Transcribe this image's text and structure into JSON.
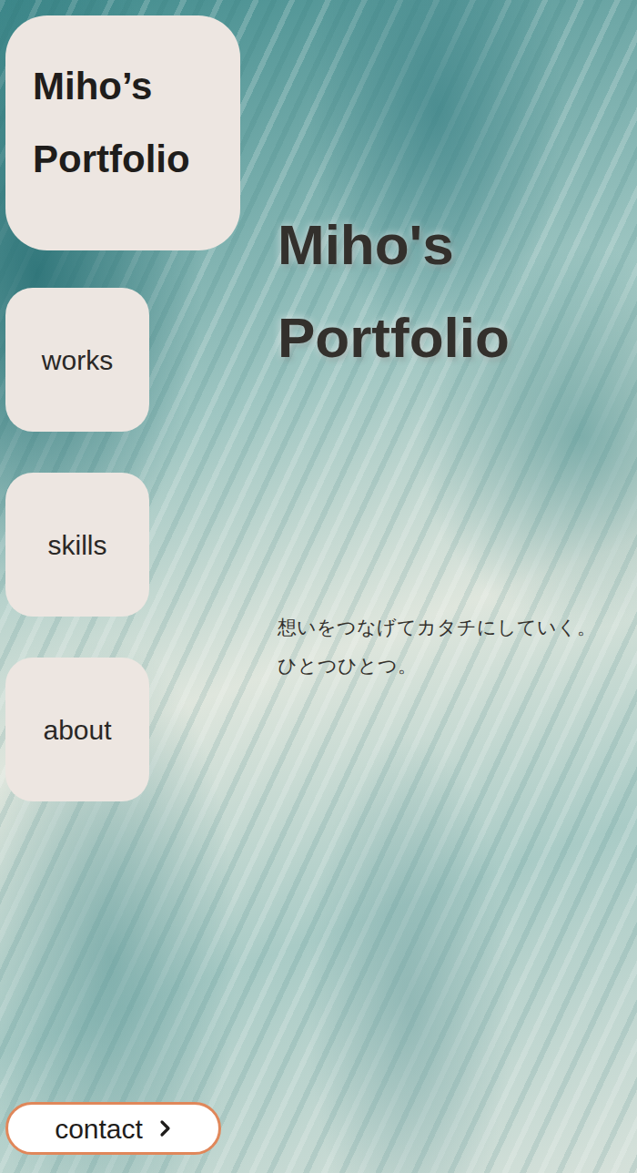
{
  "logo": "Miho’s Portfolio",
  "nav": [
    {
      "label": "works"
    },
    {
      "label": "skills"
    },
    {
      "label": "about"
    }
  ],
  "hero": {
    "title": "Miho's Portfolio",
    "tagline": [
      "想いをつなげてカタチにしていく。",
      "ひとつひとつ。"
    ]
  },
  "contact": {
    "label": "contact"
  }
}
